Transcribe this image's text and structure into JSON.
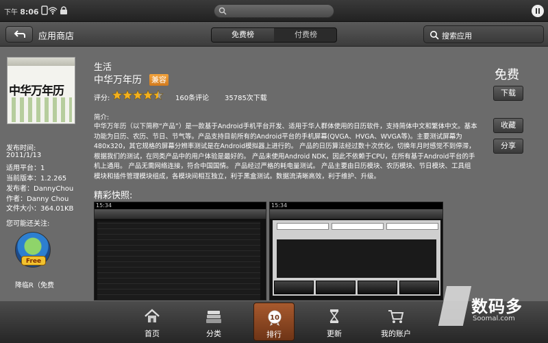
{
  "status_bar": {
    "ampm": "下午",
    "time": "8:06"
  },
  "title_bar": {
    "app_title": "应用商店",
    "tabs": [
      {
        "label": "免费榜",
        "selected": true
      },
      {
        "label": "付费榜",
        "selected": false
      }
    ],
    "search_placeholder": "搜索应用"
  },
  "app": {
    "category": "生活",
    "name": "中华万年历",
    "compat_badge": "兼容",
    "rating_label": "评分:",
    "rating_stars": 4.5,
    "reviews": "160条评论",
    "downloads": "35785次下载",
    "icon_text": "中华万年历",
    "price": "免费",
    "download_label": "下载",
    "favorite_label": "收藏",
    "share_label": "分享",
    "description_label": "简介:",
    "description": "中华万年历（以下简称“产品”）是一款基于Android手机平台开发、适用于华人群体使用的日历软件，支持简体中文和繁体中文。基本功能为日历、农历、节日、节气等。产品支持目前所有的Android平台的手机屏幕(QVGA、HVGA、WVGA等)。主要测试屏幕为480x320，其它规格的屏幕分辨率测试是在Android模拟器上进行的。 产品的日历算法经过数十次优化，切换年月时感觉不到停滞，根据我们的测试，在同类产品中的用户体验是最好的。 产品未使用Android NDK，因此不依赖于CPU，在所有基于Android平台的手机上通用。 产品无需网络连接，符合中国国情。 产品经过严格的耗电量测试。 产品主要由日历模块、农历模块、节日模块、工具组模块和插件管理模块组成，各模块间相互独立，利于黑盒测试。数据流清晰高效，利于维护、升级。"
  },
  "meta": {
    "release_label": "发布时间:",
    "release_date": "2011/1/13",
    "platform": "适用平台：1",
    "version": "当前版本：1.2.265",
    "publisher": "发布者：DannyChou",
    "author": "作者：Danny Chou",
    "size": "文件大小：364.01KB"
  },
  "recommend": {
    "label": "您可能还关注:",
    "badge": "Free",
    "app_name": "降临R（免费"
  },
  "screenshots": {
    "title": "精彩快照:",
    "shot1_status": "15:34",
    "shot2_status": "15:34"
  },
  "bottom_nav": [
    {
      "label": "首页",
      "icon": "home-icon",
      "selected": false
    },
    {
      "label": "分类",
      "icon": "category-icon",
      "selected": false
    },
    {
      "label": "排行",
      "icon": "rank-icon",
      "selected": true,
      "badge": "10"
    },
    {
      "label": "更新",
      "icon": "update-icon",
      "selected": false
    },
    {
      "label": "我的账户",
      "icon": "cart-icon",
      "selected": false
    }
  ],
  "watermark": {
    "brand": "数码多",
    "site": "Soomal.com"
  },
  "colors": {
    "background": "#6b6b6b",
    "accent_badge": "#e08a2a",
    "star": "#f2b01e",
    "nav_selected": "#8a4520"
  }
}
